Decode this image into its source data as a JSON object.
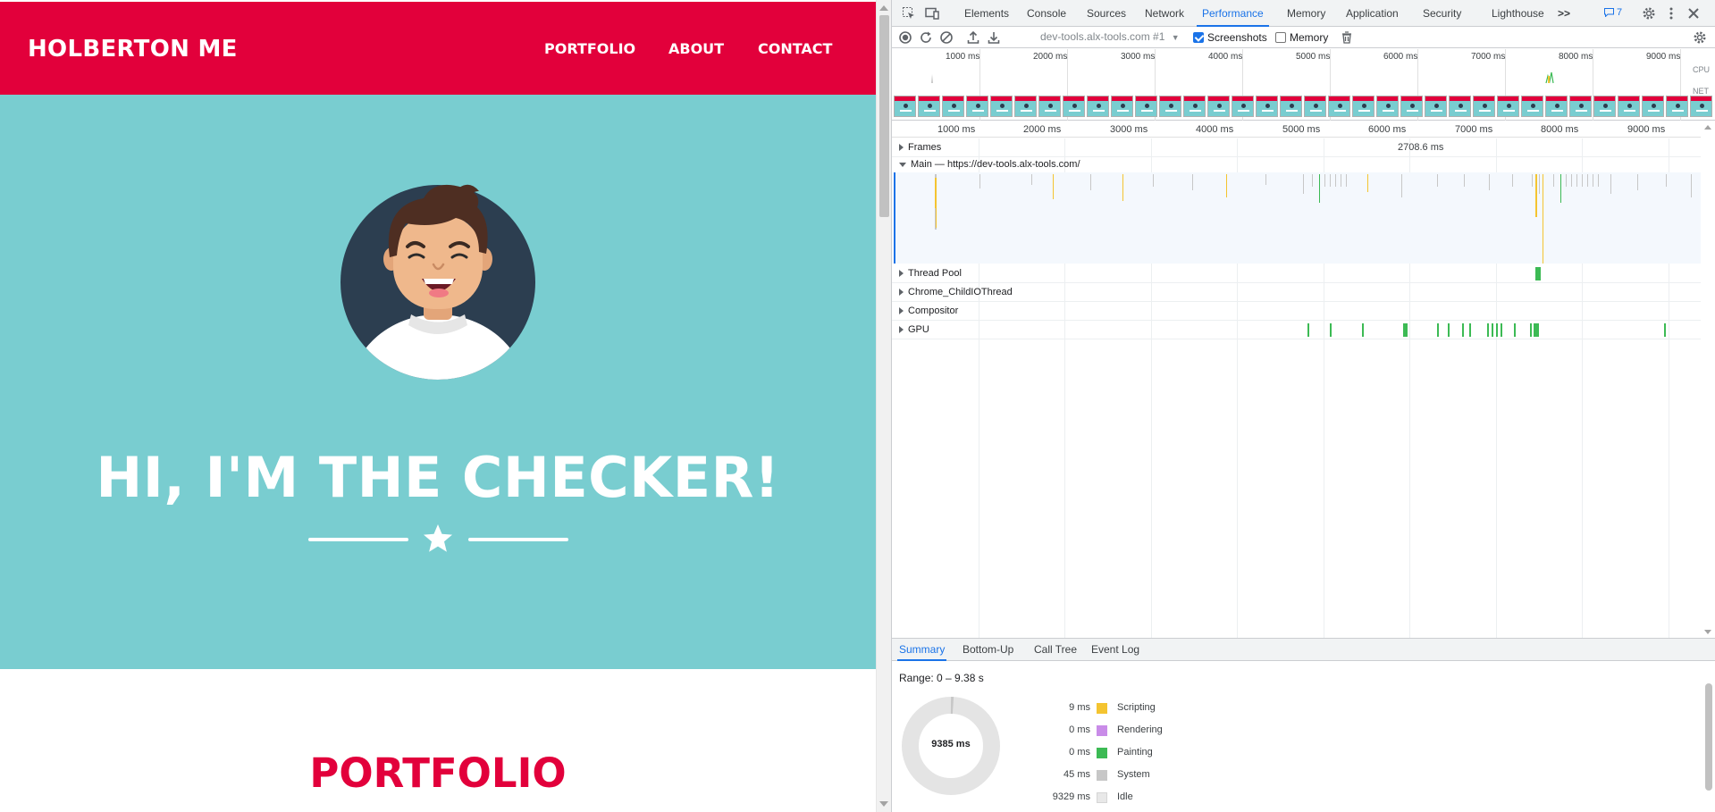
{
  "page": {
    "brand": "HOLBERTON ME",
    "nav": [
      "PORTFOLIO",
      "ABOUT",
      "CONTACT"
    ],
    "hero_title": "HI, I'M THE CHECKER!",
    "section_heading": "PORTFOLIO",
    "colors": {
      "primary_red": "#e2003b",
      "hero_teal": "#79cdd0",
      "avatar_bg": "#2c3e50"
    }
  },
  "devtools": {
    "tabs": [
      "Elements",
      "Console",
      "Sources",
      "Network",
      "Performance",
      "Memory",
      "Application",
      "Security",
      "Lighthouse"
    ],
    "active_tab": "Performance",
    "overflow_label": ">>",
    "issues_count": "7",
    "toolbar": {
      "recording_select": "dev-tools.alx-tools.com #1",
      "screenshots_label": "Screenshots",
      "screenshots_checked": true,
      "memory_label": "Memory",
      "memory_checked": false
    },
    "overview": {
      "ticks": [
        "1000 ms",
        "2000 ms",
        "3000 ms",
        "4000 ms",
        "5000 ms",
        "6000 ms",
        "7000 ms",
        "8000 ms",
        "9000 ms"
      ],
      "cpu_label": "CPU",
      "net_label": "NET"
    },
    "timeline": {
      "ticks": [
        "1000 ms",
        "2000 ms",
        "3000 ms",
        "4000 ms",
        "5000 ms",
        "6000 ms",
        "7000 ms",
        "8000 ms",
        "9000 ms"
      ],
      "frames_label": "Frames",
      "frames_duration": "2708.6 ms",
      "main_label": "Main — https://dev-tools.alx-tools.com/",
      "tracks": [
        "Thread Pool",
        "Chrome_ChildIOThread",
        "Compositor",
        "GPU"
      ]
    },
    "bottom_tabs": [
      "Summary",
      "Bottom-Up",
      "Call Tree",
      "Event Log"
    ],
    "active_bottom_tab": "Summary",
    "summary": {
      "range": "Range: 0 – 9.38 s",
      "total": "9385 ms",
      "items": [
        {
          "value": "9 ms",
          "label": "Scripting",
          "color": "#f4c430"
        },
        {
          "value": "0 ms",
          "label": "Rendering",
          "color": "#c98ce8"
        },
        {
          "value": "0 ms",
          "label": "Painting",
          "color": "#3cba54"
        },
        {
          "value": "45 ms",
          "label": "System",
          "color": "#c7c7c7"
        },
        {
          "value": "9329 ms",
          "label": "Idle",
          "color": "#e8e8e8"
        }
      ]
    }
  }
}
